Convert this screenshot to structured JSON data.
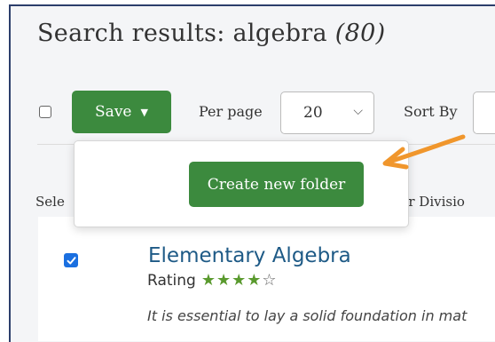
{
  "header": {
    "title_prefix": "Search results: algebra ",
    "result_count": "(80)"
  },
  "toolbar": {
    "save_label": "Save",
    "per_page_label": "Per page",
    "per_page_value": "20",
    "sort_by_label": "Sort By"
  },
  "dropdown": {
    "create_folder_label": "Create new folder"
  },
  "columns": {
    "select": "Sele",
    "division": "ver Divisio"
  },
  "results": [
    {
      "title": "Elementary Algebra",
      "rating_label": "Rating",
      "rating": 4,
      "rating_max": 5,
      "checked": true,
      "description": "It is essential to lay a solid foundation in mat"
    }
  ],
  "colors": {
    "primary_button": "#3c8a3e",
    "link": "#1e5a86",
    "annotation_arrow": "#f0962c",
    "checkbox_checked": "#1a6fe0"
  },
  "icons": {
    "save_caret": "caret-down-icon",
    "select_chevron": "chevron-down-icon",
    "arrow": "arrow-annotation-icon",
    "check": "checkmark-icon"
  }
}
